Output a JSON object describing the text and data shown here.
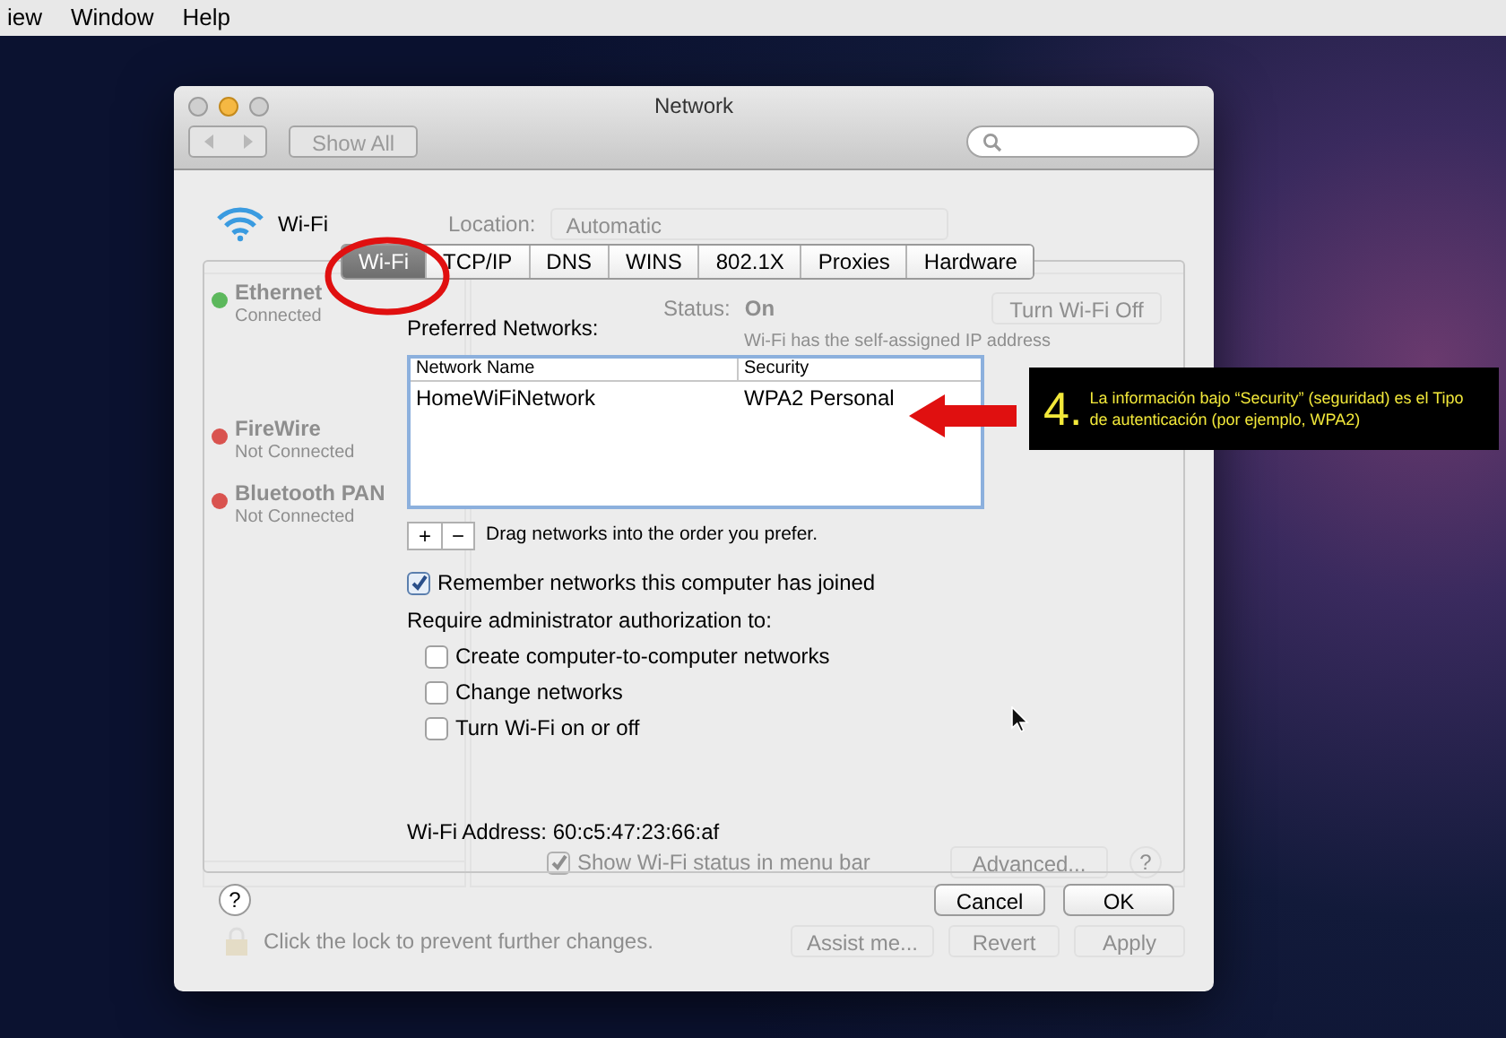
{
  "menu_bar": {
    "items": [
      "iew",
      "Window",
      "Help"
    ]
  },
  "window": {
    "title": "Network",
    "show_all_button": "Show All"
  },
  "background_pane": {
    "location_label": "Location:",
    "location_value": "Automatic",
    "services": [
      {
        "name": "Ethernet",
        "status": "Connected",
        "color": "#5cb85c"
      },
      {
        "name": "FireWire",
        "status": "Not Connected",
        "color": "#d9534f"
      },
      {
        "name": "Bluetooth PAN",
        "status": "Not Connected",
        "color": "#d9534f"
      }
    ],
    "status_label": "Status:",
    "status_value": "On",
    "turn_off_button": "Turn Wi-Fi Off",
    "status_note": "Wi-Fi has the self-assigned IP address",
    "show_status": {
      "label": "Show Wi-Fi status in menu bar",
      "checked": true
    },
    "advanced_button": "Advanced...",
    "help": "?",
    "lock_note": "Click the lock to prevent further changes.",
    "buttons": [
      "Assist me...",
      "Revert",
      "Apply"
    ]
  },
  "service_header": {
    "name": "Wi-Fi"
  },
  "tabs": [
    {
      "label": "Wi-Fi",
      "selected": true
    },
    {
      "label": "TCP/IP",
      "selected": false
    },
    {
      "label": "DNS",
      "selected": false
    },
    {
      "label": "WINS",
      "selected": false
    },
    {
      "label": "802.1X",
      "selected": false
    },
    {
      "label": "Proxies",
      "selected": false
    },
    {
      "label": "Hardware",
      "selected": false
    }
  ],
  "preferred_networks": {
    "label": "Preferred Networks:",
    "columns": [
      "Network Name",
      "Security"
    ],
    "rows": [
      [
        "HomeWiFiNetwork",
        "WPA2 Personal"
      ]
    ],
    "add": "+",
    "remove": "−",
    "hint": "Drag networks into the order you prefer."
  },
  "remember": {
    "label": "Remember networks this computer has joined",
    "checked": true
  },
  "require_label": "Require administrator authorization to:",
  "require_options": [
    {
      "label": "Create computer-to-computer networks",
      "checked": false
    },
    {
      "label": "Change networks",
      "checked": false
    },
    {
      "label": "Turn Wi-Fi on or off",
      "checked": false
    }
  ],
  "wifi_address": "Wi-Fi Address: 60:c5:47:23:66:af",
  "help": "?",
  "buttons": [
    "Cancel",
    "OK"
  ],
  "annotation": {
    "number": "4.",
    "text": "La información bajo “Security” (seguridad) es el Tipo de autenticación (por ejemplo, WPA2)"
  }
}
